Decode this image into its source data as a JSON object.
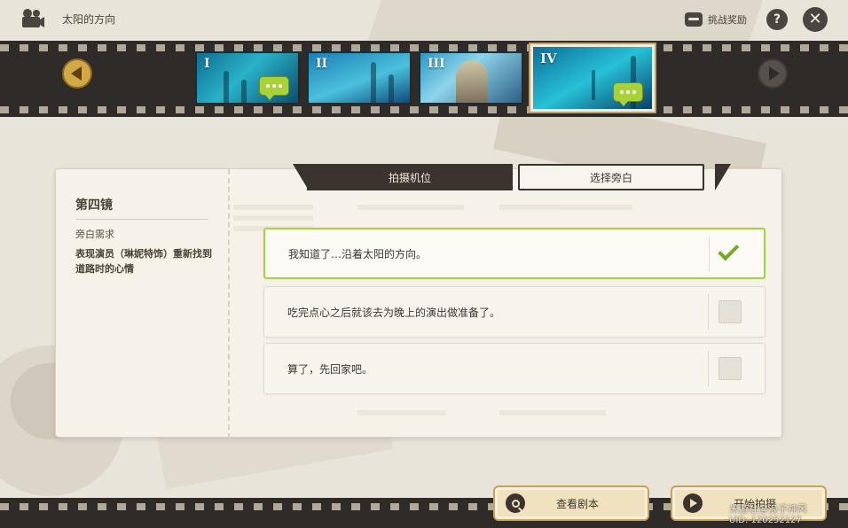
{
  "header": {
    "title": "太阳的方向",
    "reward_label": "挑战奖励",
    "help_label": "?",
    "close_label": "✕"
  },
  "filmstrip": {
    "shots": [
      {
        "numeral": "I",
        "has_narration": true
      },
      {
        "numeral": "II",
        "has_narration": false
      },
      {
        "numeral": "III",
        "has_narration": false
      },
      {
        "numeral": "IV",
        "has_narration": true,
        "selected": true
      }
    ]
  },
  "left_card": {
    "shot_title": "第四镜",
    "requirement_label": "旁白需求",
    "requirement_text": "表现演员（琳妮特饰）重新找到道路时的心情"
  },
  "tabs": {
    "camera_label": "拍摄机位",
    "narration_label": "选择旁白",
    "active": "narration"
  },
  "options": [
    {
      "text": "我知道了…沿着太阳的方向。",
      "checked": true
    },
    {
      "text": "吃完点心之后就该去为晚上的演出做准备了。",
      "checked": false
    },
    {
      "text": "算了，先回家吧。",
      "checked": false
    }
  ],
  "bottom": {
    "view_script_label": "查看剧本",
    "shoot_label": "开始拍摄",
    "watermark": "米游社@浪子神风",
    "uid": "UID: 120252127"
  },
  "colors": {
    "accent_green": "#a5d33f",
    "gold": "#d3a847",
    "film_dark": "#2f2b28"
  }
}
